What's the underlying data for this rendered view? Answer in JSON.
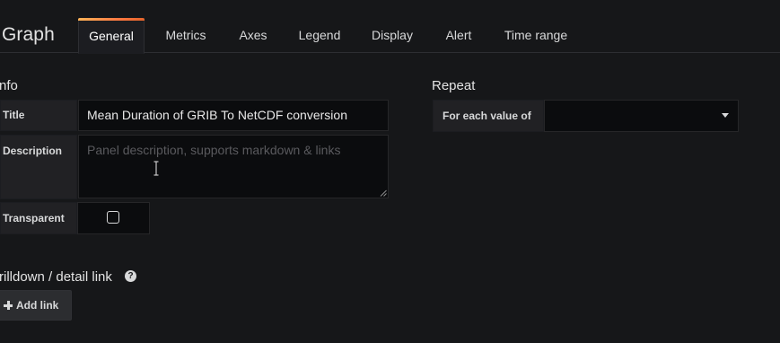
{
  "editor": {
    "title": "Graph",
    "tabs": [
      {
        "label": "General",
        "active": true
      },
      {
        "label": "Metrics",
        "active": false
      },
      {
        "label": "Axes",
        "active": false
      },
      {
        "label": "Legend",
        "active": false
      },
      {
        "label": "Display",
        "active": false
      },
      {
        "label": "Alert",
        "active": false
      },
      {
        "label": "Time range",
        "active": false
      }
    ]
  },
  "info": {
    "heading": "nfo",
    "title_label": "Title",
    "title_value": "Mean Duration of GRIB To NetCDF conversion",
    "description_label": "Description",
    "description_placeholder": "Panel description, supports markdown & links",
    "transparent_label": "Transparent",
    "transparent_checked": false
  },
  "repeat": {
    "heading": "Repeat",
    "for_each_label": "For each value of",
    "for_each_value": ""
  },
  "drilldown": {
    "heading": "rilldown / detail link",
    "help_icon": "question-circle-icon",
    "add_link_label": "Add link"
  },
  "colors": {
    "background": "#161719",
    "active_tab_accent": "#ff7941",
    "input_background": "#0b0c0e",
    "label_background": "#212124",
    "text": "#d8d9da"
  }
}
